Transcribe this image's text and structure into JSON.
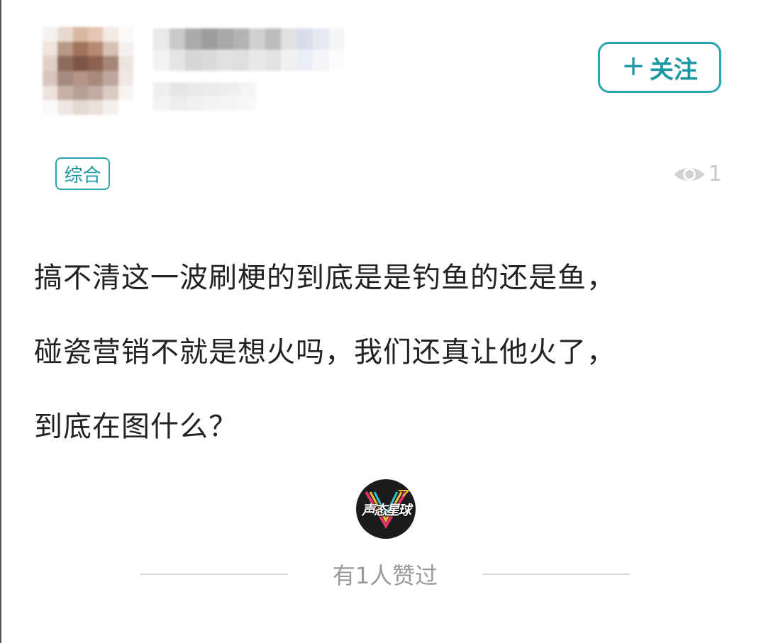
{
  "header": {
    "follow_button": {
      "plus": "+",
      "label": "关注"
    }
  },
  "tag": {
    "label": "综合"
  },
  "views": {
    "icon": "eye-icon",
    "count": "1"
  },
  "post": {
    "lines": [
      "搞不清这一波刷梗的到底是是钓鱼的还是鱼，",
      "碰瓷营销不就是想火吗，我们还真让他火了，",
      "到底在图什么？"
    ]
  },
  "brand_logo": {
    "text": "声态星球"
  },
  "likes": {
    "text": "有1人赞过"
  },
  "colors": {
    "accent": "#29a5ae",
    "accent_text": "#1b98a2",
    "body_text": "#222222",
    "muted": "#9a9a9a",
    "divider": "#d9d9d9"
  }
}
